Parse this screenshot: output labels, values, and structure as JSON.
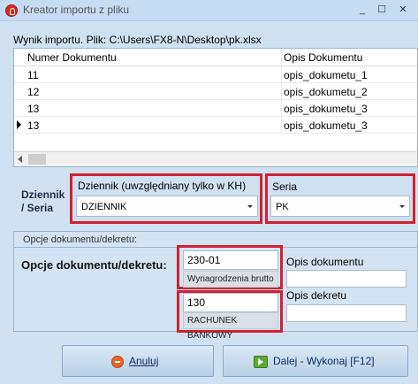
{
  "window": {
    "title": "Kreator importu z pliku",
    "minimize": "_",
    "maximize": "☐",
    "close": "✕"
  },
  "import": {
    "result_label": "Wynik importu. Plik:  C:\\Users\\FX8-N\\Desktop\\pk.xlsx",
    "columns": [
      "Numer Dokumentu",
      "Opis Dokumentu"
    ],
    "rows": [
      {
        "numer": "11",
        "opis": "opis_dokumetu_1"
      },
      {
        "numer": "12",
        "opis": "opis_dokumetu_2"
      },
      {
        "numer": "13",
        "opis": "opis_dokumetu_3"
      },
      {
        "numer": "13",
        "opis": "opis_dokumetu_3"
      }
    ]
  },
  "journal": {
    "group_label_line1": "Dziennik",
    "group_label_line2": "/ Seria",
    "dziennik_label": "Dziennik (uwzględniany tylko w KH)",
    "dziennik_value": "DZIENNIK",
    "seria_label": "Seria",
    "seria_value": "PK"
  },
  "options": {
    "group_title": "Opcje dokumentu/dekretu:",
    "label": "Opcje dokumentu/dekretu:",
    "code1_value": "230-01",
    "code1_desc": "Wynagrodzenia brutto",
    "code2_value": "130",
    "code2_desc": "RACHUNEK BANKOWY",
    "opis_dokumentu_label": "Opis dokumentu",
    "opis_dokumentu_value": "",
    "opis_dekretu_label": "Opis dekretu",
    "opis_dekretu_value": ""
  },
  "buttons": {
    "cancel_label": "Anuluj",
    "next_label": "Dalej - Wykonaj [F12]"
  },
  "colors": {
    "highlight_red": "#d32030",
    "background": "#cfe0f1"
  }
}
